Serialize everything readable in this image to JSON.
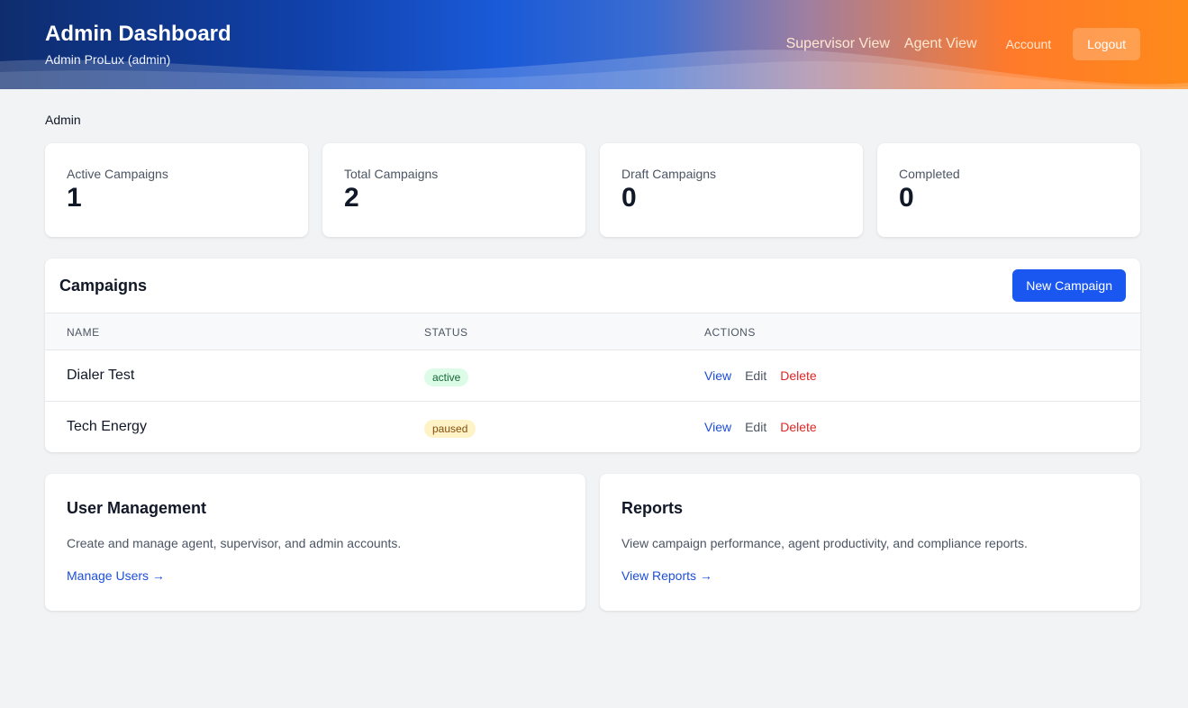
{
  "header": {
    "title": "Admin Dashboard",
    "subtitle": "Admin ProLux (admin)",
    "nav": {
      "supervisor": "Supervisor View",
      "agent": "Agent View",
      "account": "Account",
      "logout": "Logout"
    }
  },
  "breadcrumb": "Admin",
  "stats": [
    {
      "label": "Active Campaigns",
      "value": "1"
    },
    {
      "label": "Total Campaigns",
      "value": "2"
    },
    {
      "label": "Draft Campaigns",
      "value": "0"
    },
    {
      "label": "Completed",
      "value": "0"
    }
  ],
  "campaigns": {
    "title": "Campaigns",
    "new_button": "New Campaign",
    "columns": [
      "NAME",
      "STATUS",
      "ACTIONS"
    ],
    "rows": [
      {
        "name": "Dialer Test",
        "status": "active",
        "actions": [
          "View",
          "Edit",
          "Delete"
        ]
      },
      {
        "name": "Tech Energy",
        "status": "paused",
        "actions": [
          "View",
          "Edit",
          "Delete"
        ]
      }
    ]
  },
  "cards": [
    {
      "title": "User Management",
      "description": "Create and manage agent, supervisor, and admin accounts.",
      "link": "Manage Users →"
    },
    {
      "title": "Reports",
      "description": "View campaign performance, agent productivity, and compliance reports.",
      "link": "View Reports →"
    }
  ],
  "colors": {
    "primary": "#1a56f0",
    "link": "#1d4ed8",
    "danger": "#dc2626",
    "badge_active_bg": "#dcfce7",
    "badge_paused_bg": "#fef3c7"
  }
}
